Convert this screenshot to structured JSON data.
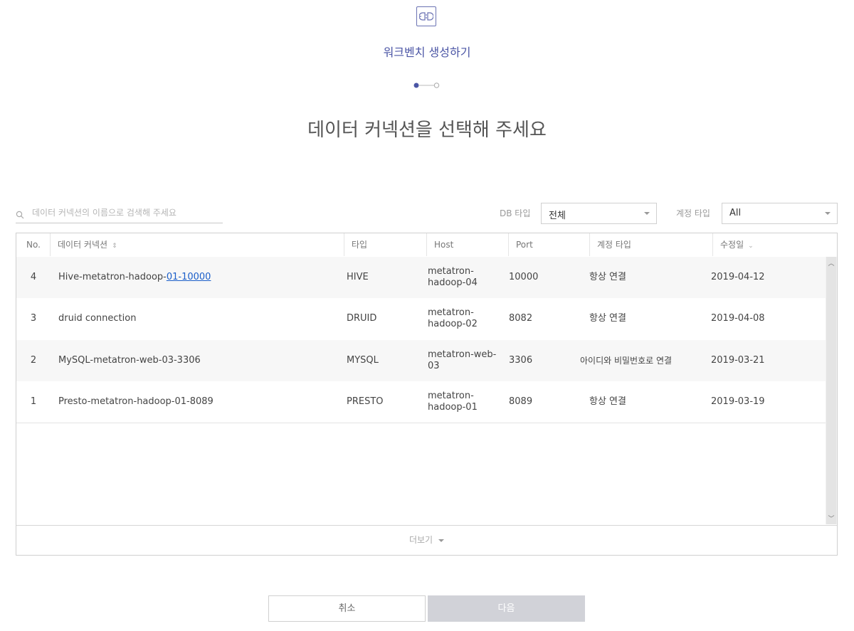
{
  "wizard": {
    "title": "워크벤치 생성하기",
    "headline": "데이터 커넥션을 선택해 주세요",
    "steps": {
      "total": 2,
      "current": 1
    }
  },
  "search": {
    "placeholder": "데이터 커넥션의 이름으로 검색해 주세요",
    "value": ""
  },
  "filters": {
    "db_type": {
      "label": "DB 타입",
      "value": "전체"
    },
    "account_type": {
      "label": "계정 타입",
      "value": "All"
    }
  },
  "table": {
    "columns": [
      "No.",
      "데이터 커넥션",
      "타입",
      "Host",
      "Port",
      "계정 타입",
      "수정일"
    ],
    "rows": [
      {
        "no": "4",
        "name_prefix": "Hive-metatron-hadoop-",
        "name_link": "01-10000",
        "type": "HIVE",
        "host_line1": "metatron-",
        "host_line2": "hadoop-04",
        "port": "10000",
        "account": "항상 연결",
        "modified": "2019-04-12"
      },
      {
        "no": "3",
        "name_prefix": "druid connection",
        "name_link": "",
        "type": "DRUID",
        "host_line1": "metatron-",
        "host_line2": "hadoop-02",
        "port": "8082",
        "account": "항상 연결",
        "modified": "2019-04-08"
      },
      {
        "no": "2",
        "name_prefix": "MySQL-metatron-web-03-3306",
        "name_link": "",
        "type": "MYSQL",
        "host_line1": "metatron-web-",
        "host_line2": "03",
        "port": "3306",
        "account": "아이디와 비밀번호로 연결",
        "modified": "2019-03-21"
      },
      {
        "no": "1",
        "name_prefix": "Presto-metatron-hadoop-01-8089",
        "name_link": "",
        "type": "PRESTO",
        "host_line1": "metatron-",
        "host_line2": "hadoop-01",
        "port": "8089",
        "account": "항상 연결",
        "modified": "2019-03-19"
      }
    ],
    "more_label": "더보기"
  },
  "buttons": {
    "cancel": "취소",
    "next": "다음"
  },
  "colors": {
    "accent": "#4b55a5",
    "link": "#1a5ec9",
    "disabled_button": "#d1d2d8"
  }
}
